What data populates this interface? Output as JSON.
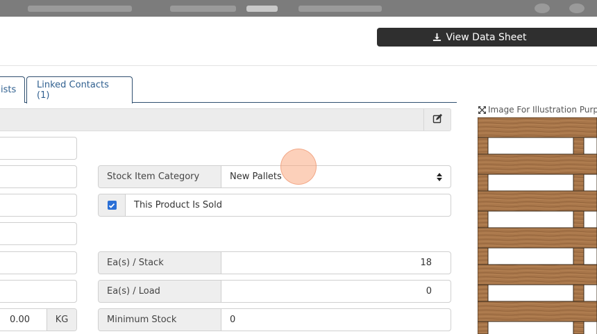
{
  "header": {
    "view_data_sheet_label": "View Data Sheet"
  },
  "tabs": [
    {
      "label": "ists"
    },
    {
      "label": "Linked Contacts (1)"
    }
  ],
  "fields": {
    "stock_item_category": {
      "label": "Stock Item Category",
      "value": "New Pallets"
    },
    "product_sold": {
      "label": "This Product Is Sold",
      "checked": true
    },
    "eas_per_stack": {
      "label": "Ea(s) / Stack",
      "value": "18"
    },
    "eas_per_load": {
      "label": "Ea(s) / Load",
      "value": "0"
    },
    "minimum_stock": {
      "label": "Minimum Stock",
      "value": "0"
    },
    "weight": {
      "value": "0.00",
      "unit": "KG"
    }
  },
  "image_caption": "Image For Illustration Purpo",
  "colors": {
    "accent_blue": "#2a6fd6",
    "tab_border": "#2f4f6f",
    "button_dark": "#2f2f2f",
    "wood": "#a8764a",
    "label_bg": "#eeeeee"
  },
  "icons": [
    "download-icon",
    "edit-icon",
    "sort-arrows-icon",
    "checkmark-icon",
    "expand-icon"
  ]
}
